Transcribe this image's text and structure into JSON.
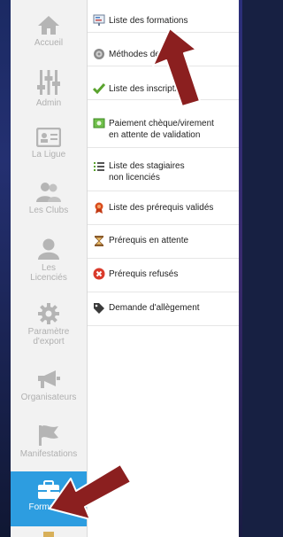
{
  "sidebar": {
    "items": [
      {
        "label": "Accueil",
        "icon": "home-icon"
      },
      {
        "label": "Admin",
        "icon": "sliders-icon"
      },
      {
        "label": "La Ligue",
        "icon": "id-card-icon"
      },
      {
        "label": "Les Clubs",
        "icon": "group-icon"
      },
      {
        "label_line1": "Les",
        "label_line2": "Licenciés",
        "icon": "user-icon"
      },
      {
        "label_line1": "Paramètre",
        "label_line2": "d'export",
        "icon": "gear-icon"
      },
      {
        "label": "Organisateurs",
        "icon": "megaphone-icon"
      },
      {
        "label": "Manifestations",
        "icon": "flag-icon"
      },
      {
        "label": "Formation",
        "icon": "briefcase-icon",
        "active": true
      }
    ]
  },
  "submenu": {
    "items": [
      {
        "label": "Liste des formations",
        "icon": "presentation-icon"
      },
      {
        "label": "Méthodes de ...",
        "icon": "cog-small-icon"
      },
      {
        "label": "Liste des inscriptions",
        "icon": "check-icon"
      },
      {
        "label_line1": "Paiement chèque/virement",
        "label_line2": "en attente de validation",
        "icon": "money-icon"
      },
      {
        "label_line1": "Liste des stagiaires",
        "label_line2": "non licenciés",
        "icon": "list-icon"
      },
      {
        "label": "Liste des prérequis validés",
        "icon": "ribbon-icon"
      },
      {
        "label": "Prérequis en attente",
        "icon": "hourglass-icon"
      },
      {
        "label": "Prérequis refusés",
        "icon": "error-icon"
      },
      {
        "label": "Demande d'allègement",
        "icon": "tag-icon"
      }
    ]
  },
  "colors": {
    "active_bg": "#2d9de0",
    "sidebar_bg": "#f2f2f2",
    "annotation_arrow": "#8b1f1f"
  }
}
